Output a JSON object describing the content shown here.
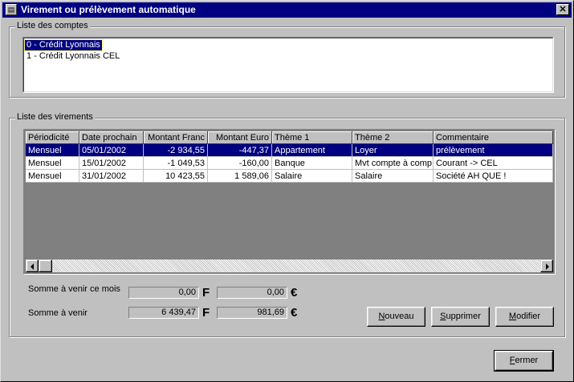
{
  "window": {
    "title": "Virement ou prélèvement automatique",
    "close_glyph": "✕",
    "icon_glyph": "▤"
  },
  "accounts_group": {
    "label": "Liste des comptes",
    "items": [
      {
        "label": "0 - Crédit Lyonnais",
        "selected": true
      },
      {
        "label": "1 - Crédit Lyonnais CEL",
        "selected": false
      }
    ]
  },
  "transfers_group": {
    "label": "Liste des virements",
    "columns": [
      "Périodicité",
      "Date prochain",
      "Montant Franc",
      "Montant Euro",
      "Thème 1",
      "Thème 2",
      "Commentaire"
    ],
    "rows": [
      {
        "cells": [
          "Mensuel",
          "05/01/2002",
          "-2 934,55",
          "-447,37",
          "Appartement",
          "Loyer",
          "prélèvement"
        ],
        "selected": true
      },
      {
        "cells": [
          "Mensuel",
          "15/01/2002",
          "-1 049,53",
          "-160,00",
          "Banque",
          "Mvt compte à comp",
          "Courant -> CEL"
        ],
        "selected": false
      },
      {
        "cells": [
          "Mensuel",
          "31/01/2002",
          "10 423,55",
          "1 589,06",
          "Salaire",
          "Salaire",
          "Société AH QUE !"
        ],
        "selected": false
      }
    ],
    "totals": {
      "month_label": "Somme à venir ce mois",
      "month_franc": "0,00",
      "month_euro": "0,00",
      "future_label": "Somme à venir",
      "future_franc": "6 439,47",
      "future_euro": "981,69",
      "franc_symbol": "F",
      "euro_symbol": "€"
    },
    "buttons": {
      "new": "Nouveau",
      "delete": "Supprimer",
      "modify": "Modifier"
    }
  },
  "footer": {
    "close": "Fermer"
  },
  "colors": {
    "titlebar": "#000080",
    "selection": "#000080",
    "face": "#c0c0c0"
  }
}
